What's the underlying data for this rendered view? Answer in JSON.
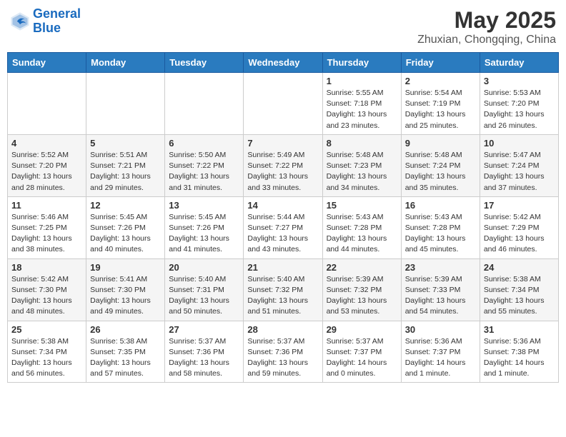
{
  "header": {
    "logo_line1": "General",
    "logo_line2": "Blue",
    "month": "May 2025",
    "location": "Zhuxian, Chongqing, China"
  },
  "weekdays": [
    "Sunday",
    "Monday",
    "Tuesday",
    "Wednesday",
    "Thursday",
    "Friday",
    "Saturday"
  ],
  "weeks": [
    [
      {
        "day": "",
        "info": ""
      },
      {
        "day": "",
        "info": ""
      },
      {
        "day": "",
        "info": ""
      },
      {
        "day": "",
        "info": ""
      },
      {
        "day": "1",
        "info": "Sunrise: 5:55 AM\nSunset: 7:18 PM\nDaylight: 13 hours\nand 23 minutes."
      },
      {
        "day": "2",
        "info": "Sunrise: 5:54 AM\nSunset: 7:19 PM\nDaylight: 13 hours\nand 25 minutes."
      },
      {
        "day": "3",
        "info": "Sunrise: 5:53 AM\nSunset: 7:20 PM\nDaylight: 13 hours\nand 26 minutes."
      }
    ],
    [
      {
        "day": "4",
        "info": "Sunrise: 5:52 AM\nSunset: 7:20 PM\nDaylight: 13 hours\nand 28 minutes."
      },
      {
        "day": "5",
        "info": "Sunrise: 5:51 AM\nSunset: 7:21 PM\nDaylight: 13 hours\nand 29 minutes."
      },
      {
        "day": "6",
        "info": "Sunrise: 5:50 AM\nSunset: 7:22 PM\nDaylight: 13 hours\nand 31 minutes."
      },
      {
        "day": "7",
        "info": "Sunrise: 5:49 AM\nSunset: 7:22 PM\nDaylight: 13 hours\nand 33 minutes."
      },
      {
        "day": "8",
        "info": "Sunrise: 5:48 AM\nSunset: 7:23 PM\nDaylight: 13 hours\nand 34 minutes."
      },
      {
        "day": "9",
        "info": "Sunrise: 5:48 AM\nSunset: 7:24 PM\nDaylight: 13 hours\nand 35 minutes."
      },
      {
        "day": "10",
        "info": "Sunrise: 5:47 AM\nSunset: 7:24 PM\nDaylight: 13 hours\nand 37 minutes."
      }
    ],
    [
      {
        "day": "11",
        "info": "Sunrise: 5:46 AM\nSunset: 7:25 PM\nDaylight: 13 hours\nand 38 minutes."
      },
      {
        "day": "12",
        "info": "Sunrise: 5:45 AM\nSunset: 7:26 PM\nDaylight: 13 hours\nand 40 minutes."
      },
      {
        "day": "13",
        "info": "Sunrise: 5:45 AM\nSunset: 7:26 PM\nDaylight: 13 hours\nand 41 minutes."
      },
      {
        "day": "14",
        "info": "Sunrise: 5:44 AM\nSunset: 7:27 PM\nDaylight: 13 hours\nand 43 minutes."
      },
      {
        "day": "15",
        "info": "Sunrise: 5:43 AM\nSunset: 7:28 PM\nDaylight: 13 hours\nand 44 minutes."
      },
      {
        "day": "16",
        "info": "Sunrise: 5:43 AM\nSunset: 7:28 PM\nDaylight: 13 hours\nand 45 minutes."
      },
      {
        "day": "17",
        "info": "Sunrise: 5:42 AM\nSunset: 7:29 PM\nDaylight: 13 hours\nand 46 minutes."
      }
    ],
    [
      {
        "day": "18",
        "info": "Sunrise: 5:42 AM\nSunset: 7:30 PM\nDaylight: 13 hours\nand 48 minutes."
      },
      {
        "day": "19",
        "info": "Sunrise: 5:41 AM\nSunset: 7:30 PM\nDaylight: 13 hours\nand 49 minutes."
      },
      {
        "day": "20",
        "info": "Sunrise: 5:40 AM\nSunset: 7:31 PM\nDaylight: 13 hours\nand 50 minutes."
      },
      {
        "day": "21",
        "info": "Sunrise: 5:40 AM\nSunset: 7:32 PM\nDaylight: 13 hours\nand 51 minutes."
      },
      {
        "day": "22",
        "info": "Sunrise: 5:39 AM\nSunset: 7:32 PM\nDaylight: 13 hours\nand 53 minutes."
      },
      {
        "day": "23",
        "info": "Sunrise: 5:39 AM\nSunset: 7:33 PM\nDaylight: 13 hours\nand 54 minutes."
      },
      {
        "day": "24",
        "info": "Sunrise: 5:38 AM\nSunset: 7:34 PM\nDaylight: 13 hours\nand 55 minutes."
      }
    ],
    [
      {
        "day": "25",
        "info": "Sunrise: 5:38 AM\nSunset: 7:34 PM\nDaylight: 13 hours\nand 56 minutes."
      },
      {
        "day": "26",
        "info": "Sunrise: 5:38 AM\nSunset: 7:35 PM\nDaylight: 13 hours\nand 57 minutes."
      },
      {
        "day": "27",
        "info": "Sunrise: 5:37 AM\nSunset: 7:36 PM\nDaylight: 13 hours\nand 58 minutes."
      },
      {
        "day": "28",
        "info": "Sunrise: 5:37 AM\nSunset: 7:36 PM\nDaylight: 13 hours\nand 59 minutes."
      },
      {
        "day": "29",
        "info": "Sunrise: 5:37 AM\nSunset: 7:37 PM\nDaylight: 14 hours\nand 0 minutes."
      },
      {
        "day": "30",
        "info": "Sunrise: 5:36 AM\nSunset: 7:37 PM\nDaylight: 14 hours\nand 1 minute."
      },
      {
        "day": "31",
        "info": "Sunrise: 5:36 AM\nSunset: 7:38 PM\nDaylight: 14 hours\nand 1 minute."
      }
    ]
  ]
}
